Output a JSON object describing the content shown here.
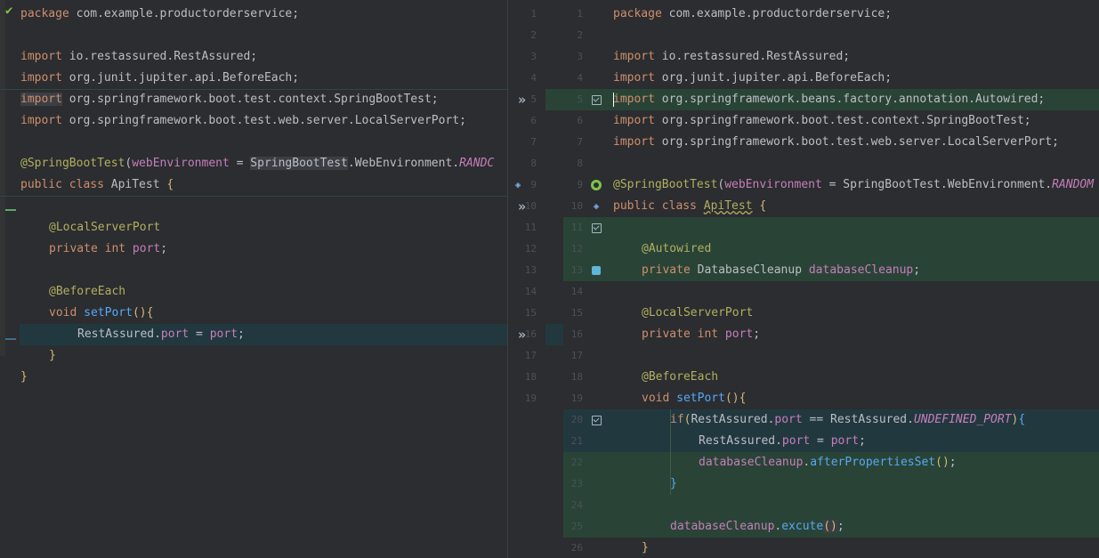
{
  "colors": {
    "background": "#2b2d30",
    "added_block": "#294436",
    "modified_block": "#22383f",
    "keyword": "#cf8e6d",
    "field": "#c77dbb",
    "annotation": "#b3ae60",
    "function": "#56a8f5",
    "line_number": "#4b5059"
  },
  "left": {
    "package_kw": "package",
    "package_name": " com.example.productorderservice;",
    "import_kw": "import",
    "import_1": " io.restassured.RestAssured;",
    "import_2": " org.junit.jupiter.api.BeforeEach;",
    "import_3": " org.springframework.boot.test.context.SpringBootTest;",
    "import_4": " org.springframework.boot.test.web.server.LocalServerPort;",
    "annotation": "@SpringBootTest",
    "ann_open": "(",
    "ann_param": "webEnvironment",
    "ann_eq": " = ",
    "ann_class": "SpringBootTest",
    "ann_rest": ".WebEnvironment.",
    "ann_const": "RANDC",
    "class_decl_kw": "public class",
    "class_name": " ApiTest ",
    "open_brace": "{",
    "field_annotation": "@LocalServerPort",
    "field_decl_kw": "private int",
    "field_name": " port",
    "semicolon": ";",
    "method_annotation": "@BeforeEach",
    "method_kw": "void",
    "method_name": " setPort",
    "method_parens": "()",
    "method_brace": "{",
    "assign_class": "RestAssured.",
    "assign_field": "port",
    "assign_eq": " = ",
    "assign_value": "port",
    "assign_semi": ";",
    "inner_close": "}",
    "outer_close": "}",
    "line_numbers": [
      "1",
      "2",
      "3",
      "4",
      "5",
      "6",
      "7",
      "8",
      "9",
      "10",
      "11",
      "12",
      "13",
      "14",
      "15",
      "16",
      "17",
      "18",
      "19"
    ]
  },
  "right": {
    "package_kw": "package",
    "package_name": " com.example.productorderservice;",
    "import_kw": "import",
    "import_1": " io.restassured.RestAssured;",
    "import_2": " org.junit.jupiter.api.BeforeEach;",
    "import_3": " org.springframework.beans.factory.annotation.Autowired;",
    "import_4": " org.springframework.boot.test.context.SpringBootTest;",
    "import_5": " org.springframework.boot.test.web.server.LocalServerPort;",
    "annotation": "@SpringBootTest",
    "ann_open": "(",
    "ann_param": "webEnvironment",
    "ann_eq": " = ",
    "ann_class": "SpringBootTest",
    "ann_rest": ".WebEnvironment.",
    "ann_const": "RANDOM",
    "class_decl_kw": "public class",
    "class_space": " ",
    "class_name": "ApiTest",
    "class_space2": " ",
    "open_brace": "{",
    "autowired": "@Autowired",
    "cleanup_decl_kw": "private",
    "cleanup_type": " DatabaseCleanup ",
    "cleanup_name": "databaseCleanup",
    "semicolon": ";",
    "field_annotation": "@LocalServerPort",
    "field_decl_kw": "private int",
    "field_name": " port",
    "method_annotation": "@BeforeEach",
    "method_kw": "void",
    "method_name": " setPort",
    "method_parens": "()",
    "method_brace": "{",
    "if_kw": "if",
    "if_open": "(",
    "if_class": "RestAssured.",
    "if_field": "port",
    "if_op": " == ",
    "if_class2": "RestAssured.",
    "if_const": "UNDEFINED_PORT",
    "if_close": ")",
    "if_brace": "{",
    "assign_class": "RestAssured.",
    "assign_field": "port",
    "assign_eq": " = ",
    "assign_value": "port",
    "assign_semi": ";",
    "after_obj": "databaseCleanup",
    "after_dot": ".",
    "after_fn": "afterPropertiesSet",
    "after_parens": "()",
    "after_semi": ";",
    "if_close_brace": "}",
    "exec_obj": "databaseCleanup",
    "exec_dot": ".",
    "exec_fn": "excute",
    "exec_parens": "()",
    "exec_semi": ";",
    "method_close": "}",
    "line_numbers": [
      "1",
      "2",
      "3",
      "4",
      "5",
      "6",
      "7",
      "8",
      "9",
      "10",
      "11",
      "12",
      "13",
      "14",
      "15",
      "16",
      "17",
      "18",
      "19",
      "20",
      "21",
      "22",
      "23",
      "24",
      "25",
      "26"
    ]
  },
  "icons": {
    "left_top": "checkmark-icon",
    "merge_5": "apply-change-chevron-icon",
    "merge_10": "apply-change-chevron-icon",
    "merge_16": "apply-change-chevron-icon",
    "left_run_9": "run-test-icon",
    "right_check_5": "accept-checkbox-icon",
    "right_bean_9": "spring-bean-icon",
    "right_run_10": "run-test-icon",
    "right_check_11": "accept-checkbox-icon",
    "right_stack_13": "autowired-bean-icon",
    "right_check_20": "accept-checkbox-icon"
  }
}
